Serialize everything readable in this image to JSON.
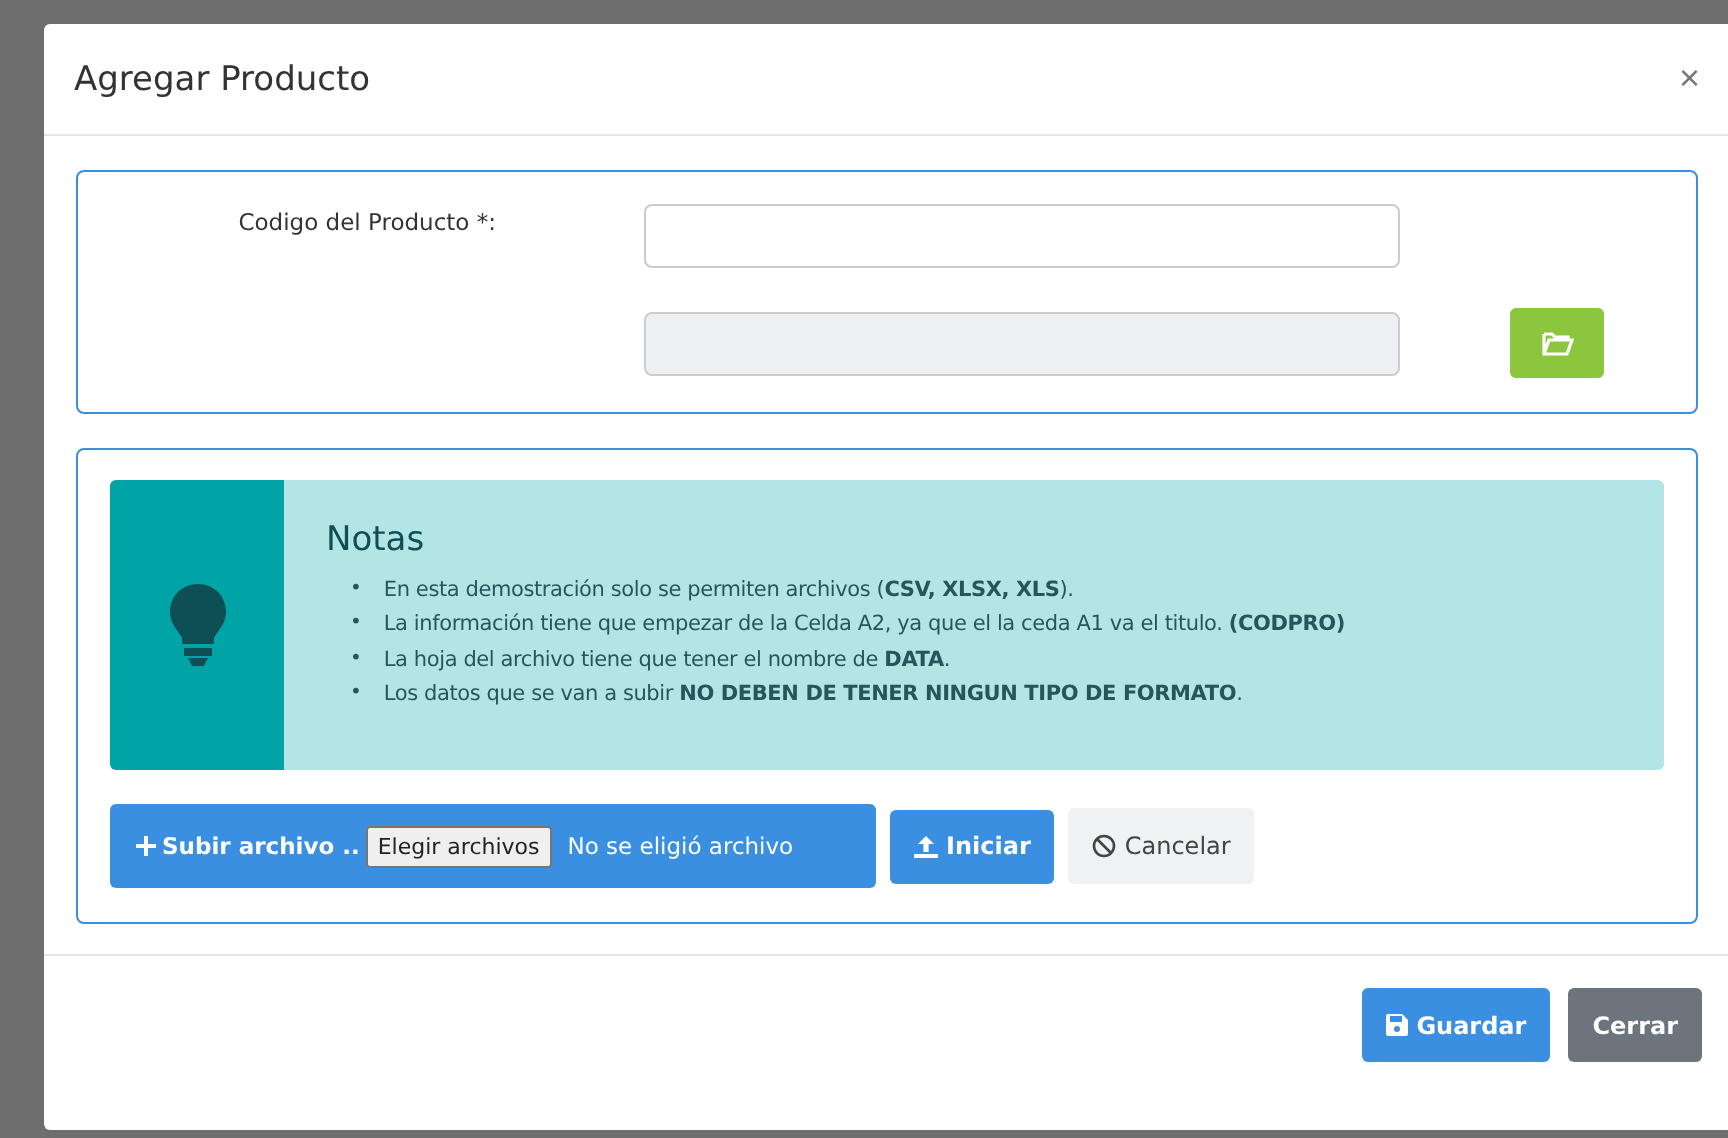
{
  "modal": {
    "title": "Agregar Producto",
    "close": "×"
  },
  "form": {
    "code_label": "Codigo del Producto *:",
    "file_path_disabled": true
  },
  "notes": {
    "title": "Notas",
    "bullet": "•",
    "items": [
      "En esta demostración solo se permiten archivos (**CSV, XLSX, XLS**).",
      "La información tiene que empezar de la Celda A2, ya que el la ceda A1 va el titulo. **(CODPRO)**",
      "La hoja del archivo tiene que tener el nombre de **DATA**.",
      "Los datos que se van a subir **NO DEBEN DE TENER NINGUN TIPO DE FORMATO**."
    ]
  },
  "upload": {
    "label": "Subir archivo ..",
    "choose": "Elegir archivos",
    "no_file": "No se eligió archivo",
    "start": "Iniciar",
    "cancel": "Cancelar"
  },
  "footer": {
    "save": "Guardar",
    "close": "Cerrar"
  }
}
